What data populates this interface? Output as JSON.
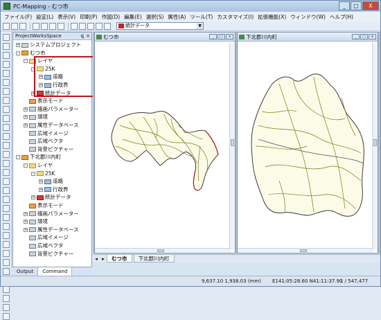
{
  "window": {
    "title": "PC-Mapping - むつ市",
    "minimize": "_",
    "maximize": "□",
    "close": "X"
  },
  "menu": [
    "ファイル(F)",
    "設定(L)",
    "表示(V)",
    "印刷(P)",
    "作図(D)",
    "編集(E)",
    "選択(S)",
    "属性(A)",
    "ツール(T)",
    "カスタマイズ(I)",
    "拡張機能(X)",
    "ウィンドウ(W)",
    "ヘルプ(H)"
  ],
  "toolbar": {
    "layer_select": "統計データ"
  },
  "panel": {
    "title": "ProjectWorksSpace",
    "pin": "ꝗ",
    "close": "×"
  },
  "tree": [
    {
      "label": "システムプロジェクト",
      "indent": 0,
      "exp": "+",
      "icon": "gray"
    },
    {
      "label": "むつ市",
      "indent": 0,
      "exp": "-",
      "icon": "orange"
    },
    {
      "label": "レイヤ",
      "indent": 1,
      "exp": "-",
      "icon": "folder"
    },
    {
      "label": "25K",
      "indent": 2,
      "exp": "-",
      "icon": "folder"
    },
    {
      "label": "道路",
      "indent": 3,
      "exp": "+",
      "icon": "blue"
    },
    {
      "label": "行政界",
      "indent": 3,
      "exp": "+",
      "icon": "blue"
    },
    {
      "label": "統計データ",
      "indent": 2,
      "exp": "+",
      "icon": "red"
    },
    {
      "label": "表示モード",
      "indent": 1,
      "exp": "",
      "icon": "orange"
    },
    {
      "label": "描画パラメーター",
      "indent": 1,
      "exp": "+",
      "icon": "gray"
    },
    {
      "label": "環境",
      "indent": 1,
      "exp": "+",
      "icon": "gray"
    },
    {
      "label": "属性データベース",
      "indent": 1,
      "exp": "+",
      "icon": "gray"
    },
    {
      "label": "広域イメージ",
      "indent": 1,
      "exp": "",
      "icon": "gray"
    },
    {
      "label": "広域ベクタ",
      "indent": 1,
      "exp": "",
      "icon": "gray"
    },
    {
      "label": "背景ピクチャー",
      "indent": 1,
      "exp": "",
      "icon": "gray"
    },
    {
      "label": "下北郡川内町",
      "indent": 0,
      "exp": "-",
      "icon": "orange"
    },
    {
      "label": "レイヤ",
      "indent": 1,
      "exp": "-",
      "icon": "folder"
    },
    {
      "label": "25K",
      "indent": 2,
      "exp": "-",
      "icon": "folder"
    },
    {
      "label": "道路",
      "indent": 3,
      "exp": "+",
      "icon": "blue"
    },
    {
      "label": "行政界",
      "indent": 3,
      "exp": "+",
      "icon": "blue"
    },
    {
      "label": "統計データ",
      "indent": 2,
      "exp": "+",
      "icon": "red"
    },
    {
      "label": "表示モード",
      "indent": 1,
      "exp": "",
      "icon": "orange"
    },
    {
      "label": "描画パラメーター",
      "indent": 1,
      "exp": "+",
      "icon": "gray"
    },
    {
      "label": "環境",
      "indent": 1,
      "exp": "+",
      "icon": "gray"
    },
    {
      "label": "属性データベース",
      "indent": 1,
      "exp": "+",
      "icon": "gray"
    },
    {
      "label": "広域イメージ",
      "indent": 1,
      "exp": "",
      "icon": "gray"
    },
    {
      "label": "広域ベクタ",
      "indent": 1,
      "exp": "",
      "icon": "gray"
    },
    {
      "label": "背景ピクチャー",
      "indent": 1,
      "exp": "",
      "icon": "gray"
    }
  ],
  "bottom_tabs": {
    "output": "Output",
    "command": "Command"
  },
  "map_windows": [
    {
      "title": "むつ市"
    },
    {
      "title": "下北郡川内町"
    }
  ],
  "doc_tabs": [
    "むつ市",
    "下北郡川内町"
  ],
  "status": {
    "coords": "9,637.10  1,938.03 (mm)",
    "geo": "E141:05:28.60 N41:11:37.90",
    "scale": "1 / 547,477"
  },
  "colors": {
    "road": "#8a8a1a",
    "boundary": "#333333",
    "highlight": "#c0121c"
  }
}
